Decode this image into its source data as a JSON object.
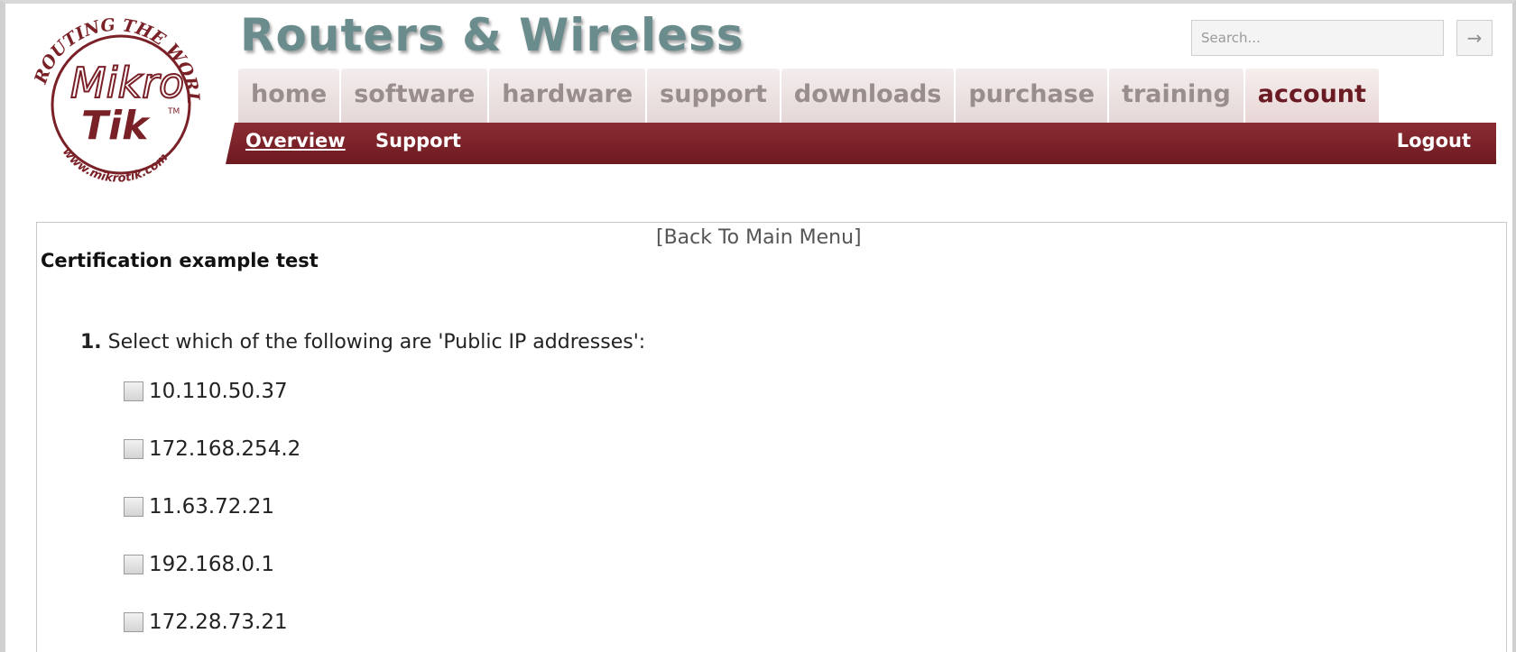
{
  "logo": {
    "top_text": "ROUTING THE WORLD",
    "brand_line1": "Mikro",
    "brand_line2": "Tik",
    "trademark": "TM",
    "bottom_text": "www.mikrotik.com"
  },
  "header": {
    "site_title": "Routers & Wireless",
    "search": {
      "placeholder": "Search...",
      "go_icon": "arrow-right-icon"
    }
  },
  "nav": {
    "tabs": [
      {
        "label": "home",
        "active": false
      },
      {
        "label": "software",
        "active": false
      },
      {
        "label": "hardware",
        "active": false
      },
      {
        "label": "support",
        "active": false
      },
      {
        "label": "downloads",
        "active": false
      },
      {
        "label": "purchase",
        "active": false
      },
      {
        "label": "training",
        "active": false
      },
      {
        "label": "account",
        "active": true
      }
    ],
    "sub": {
      "overview": "Overview",
      "support": "Support",
      "logout": "Logout"
    }
  },
  "main": {
    "back_link": "[Back To Main Menu]",
    "test_title": "Certification example test",
    "question": {
      "number": "1.",
      "text": "Select which of the following are 'Public IP addresses':",
      "options": [
        "10.110.50.37",
        "172.168.254.2",
        "11.63.72.21",
        "192.168.0.1",
        "172.28.73.21"
      ]
    }
  },
  "colors": {
    "brand_dark_red": "#7a2027",
    "title_teal": "#6b8c8c",
    "tab_bg": "#ece2e2"
  }
}
